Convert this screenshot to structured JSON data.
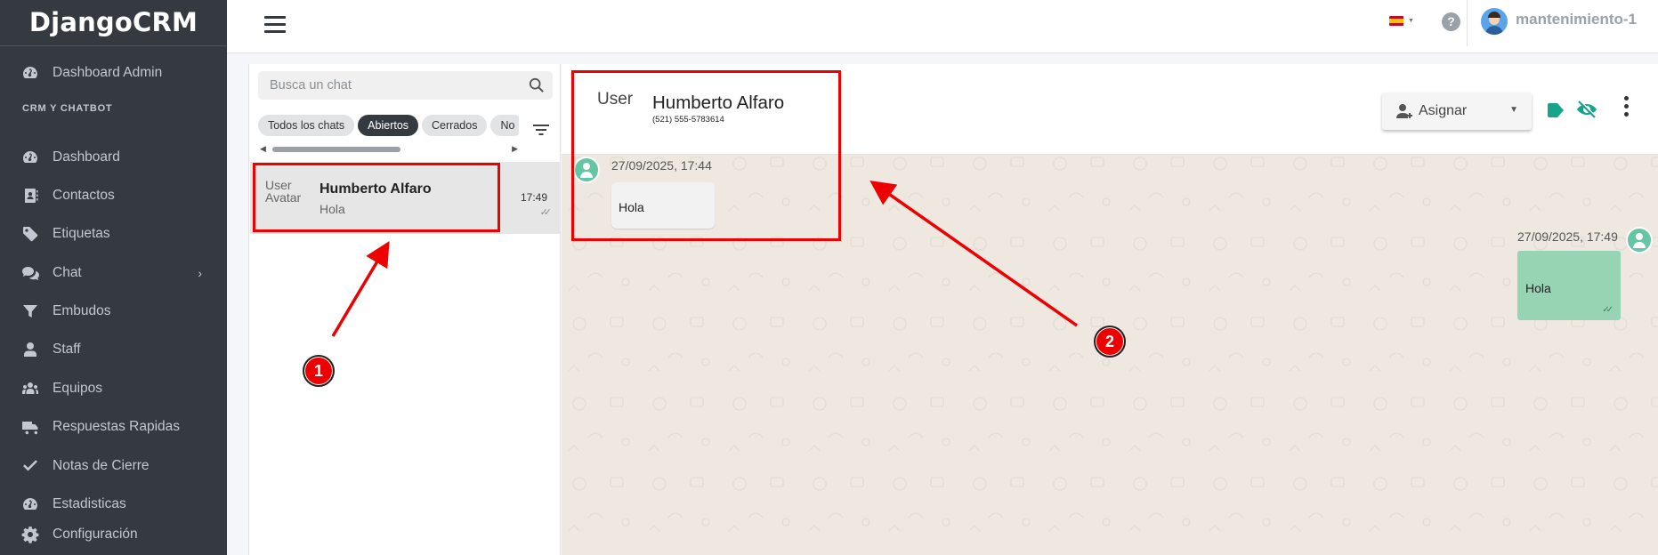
{
  "brand": "DjangoCRM",
  "sidebar": {
    "dashboard_admin": "Dashboard Admin",
    "section_header": "CRM Y CHATBOT",
    "items": [
      {
        "label": "Dashboard",
        "icon": "gauge-icon"
      },
      {
        "label": "Contactos",
        "icon": "address-book-icon"
      },
      {
        "label": "Etiquetas",
        "icon": "tags-icon"
      },
      {
        "label": "Chat",
        "icon": "comments-icon",
        "chevron": "›"
      },
      {
        "label": "Embudos",
        "icon": "filter-icon"
      },
      {
        "label": "Staff",
        "icon": "user-icon"
      },
      {
        "label": "Equipos",
        "icon": "users-icon"
      },
      {
        "label": "Respuestas Rapidas",
        "icon": "truck-fast-icon"
      },
      {
        "label": "Notas de Cierre",
        "icon": "check-icon"
      },
      {
        "label": "Estadisticas",
        "icon": "gauge-icon"
      },
      {
        "label": "Configuración",
        "icon": "gear-icon"
      }
    ]
  },
  "topbar": {
    "language": "es",
    "help": "?",
    "user_name": "mantenimiento-1"
  },
  "chat_list": {
    "search_placeholder": "Busca un chat",
    "filters": [
      "Todos los chats",
      "Abiertos",
      "Cerrados",
      "No"
    ],
    "active_filter": "Abiertos",
    "chats": [
      {
        "name": "Humberto Alfaro",
        "preview": "Hola",
        "time": "17:49",
        "avatar_alt": "User Avatar",
        "status": "read"
      }
    ]
  },
  "conversation": {
    "contact_name": "Humberto Alfaro",
    "contact_phone": "(521) 555-5783614",
    "avatar_alt": "User",
    "assign_label": "Asignar",
    "messages": [
      {
        "direction": "incoming",
        "timestamp": "27/09/2025, 17:44",
        "text": "Hola"
      },
      {
        "direction": "outgoing",
        "timestamp": "27/09/2025, 17:49",
        "text": "Hola",
        "status": "read"
      }
    ]
  },
  "annotations": {
    "markers": [
      "1",
      "2"
    ],
    "color": "#e00000"
  },
  "colors": {
    "sidebar_bg": "#343a40",
    "accent_teal": "#17a589",
    "outgoing_bubble": "#97d4b4",
    "chat_bg": "#eee8e1"
  }
}
